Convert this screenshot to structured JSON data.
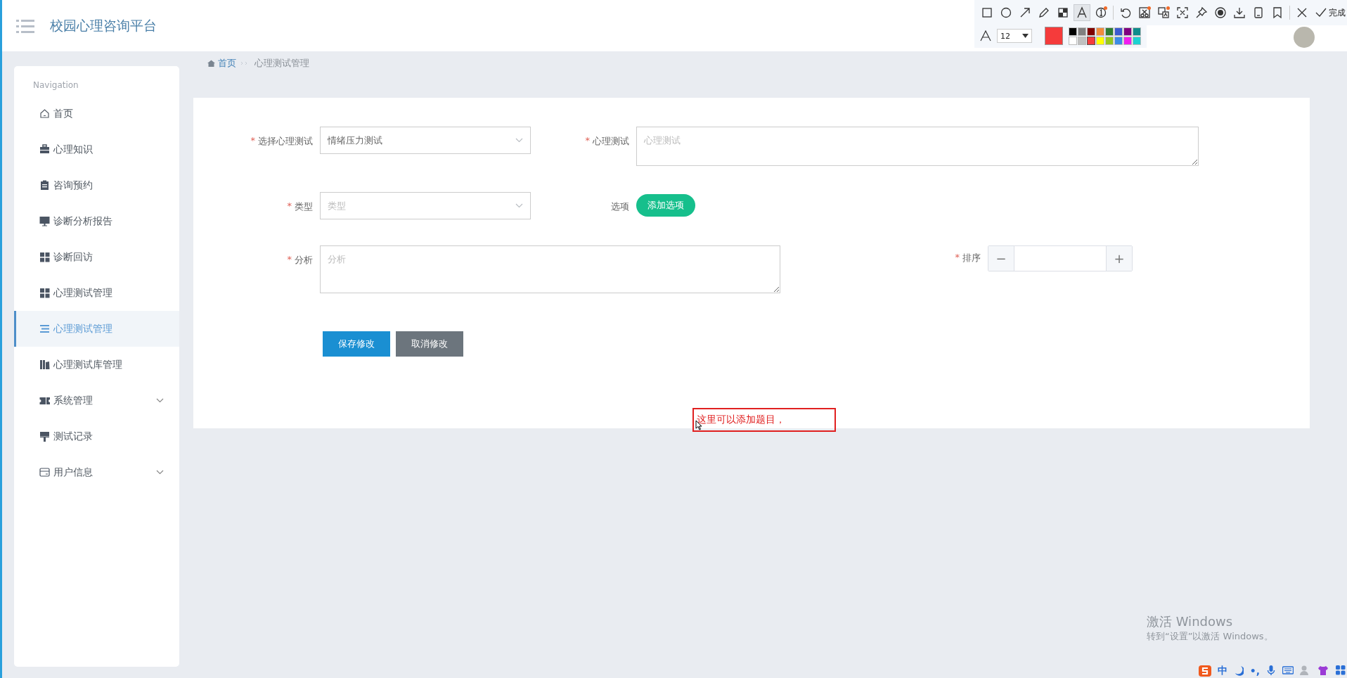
{
  "header": {
    "title": "校园心理咨询平台"
  },
  "breadcrumb": [
    {
      "label": "首页",
      "kind": "link"
    },
    {
      "label": "心理测试管理",
      "kind": "current"
    }
  ],
  "sidebar": {
    "heading": "Navigation",
    "items": [
      {
        "label": "首页",
        "kind": "home",
        "selected": false,
        "expandable": false
      },
      {
        "label": "心理知识",
        "kind": "briefcase",
        "selected": false,
        "expandable": false
      },
      {
        "label": "咨询预约",
        "kind": "clipboard",
        "selected": false,
        "expandable": false
      },
      {
        "label": "诊断分析报告",
        "kind": "monitor",
        "selected": false,
        "expandable": false
      },
      {
        "label": "诊断回访",
        "kind": "grid",
        "selected": false,
        "expandable": false
      },
      {
        "label": "心理测试管理",
        "kind": "grid",
        "selected": false,
        "expandable": false
      },
      {
        "label": "心理测试管理",
        "kind": "list",
        "selected": true,
        "expandable": false
      },
      {
        "label": "心理测试库管理",
        "kind": "books",
        "selected": false,
        "expandable": false
      },
      {
        "label": "系统管理",
        "kind": "ticket",
        "selected": false,
        "expandable": true
      },
      {
        "label": "测试记录",
        "kind": "brush",
        "selected": false,
        "expandable": false
      },
      {
        "label": "用户信息",
        "kind": "card",
        "selected": false,
        "expandable": true
      }
    ]
  },
  "form": {
    "rows": [
      [
        {
          "kind": "select",
          "mark": "*",
          "label": "选择心理测试",
          "value": "情绪压力测试"
        },
        {
          "kind": "textarea",
          "mark": "*",
          "label": "心理测试",
          "placeholder": "心理测试"
        }
      ],
      [
        {
          "kind": "select",
          "mark": "*",
          "label": "类型",
          "placeholder": "类型"
        },
        {
          "kind": "button",
          "label": "选项",
          "button": "添加选项"
        }
      ],
      [
        {
          "kind": "textarea",
          "mark": "*",
          "label": "分析",
          "placeholder": "分析"
        },
        {
          "kind": "stepper",
          "mark": "*",
          "label": "排序",
          "minus": "−",
          "plus": "+"
        }
      ]
    ],
    "buttons": [
      {
        "label": "保存修改",
        "kind": "primary"
      },
      {
        "label": "取消修改",
        "kind": "secondary"
      }
    ]
  },
  "annotation": {
    "text": "这里可以添加题目，"
  },
  "capture_toolbar": {
    "tools": [
      {
        "kind": "rect",
        "selected": false,
        "badge": false
      },
      {
        "kind": "ellipse",
        "selected": false,
        "badge": false
      },
      {
        "kind": "arrow",
        "selected": false,
        "badge": false
      },
      {
        "kind": "pencil",
        "selected": false,
        "badge": false
      },
      {
        "kind": "mosaic",
        "selected": false,
        "badge": false
      },
      {
        "kind": "text",
        "selected": true,
        "badge": false
      },
      {
        "kind": "number",
        "selected": false,
        "badge": true
      },
      {
        "kind": "sep"
      },
      {
        "kind": "undo",
        "selected": false,
        "badge": false
      },
      {
        "kind": "scissors",
        "selected": false,
        "badge": true
      },
      {
        "kind": "translate",
        "selected": false,
        "badge": true
      },
      {
        "kind": "ocr",
        "selected": false,
        "badge": false
      },
      {
        "kind": "pin",
        "selected": false,
        "badge": false
      },
      {
        "kind": "record",
        "selected": false,
        "badge": false
      },
      {
        "kind": "download",
        "selected": false,
        "badge": false
      },
      {
        "kind": "phone",
        "selected": false,
        "badge": false
      },
      {
        "kind": "bookmark",
        "selected": false,
        "badge": false
      },
      {
        "kind": "sep"
      },
      {
        "kind": "close",
        "selected": false,
        "badge": false
      }
    ],
    "done": "完成",
    "font_size": "12",
    "palette": [
      {
        "color": "#000000",
        "selected": false
      },
      {
        "color": "#808080",
        "selected": false
      },
      {
        "color": "#800000",
        "selected": false
      },
      {
        "color": "#f08c3c",
        "selected": false
      },
      {
        "color": "#2e7d32",
        "selected": false
      },
      {
        "color": "#3c5ad2",
        "selected": false
      },
      {
        "color": "#800080",
        "selected": false
      },
      {
        "color": "#0f8c8c",
        "selected": false
      },
      {
        "color": "#ffffff",
        "selected": false
      },
      {
        "color": "#c0c0c0",
        "selected": false
      },
      {
        "color": "#f53b3b",
        "selected": true
      },
      {
        "color": "#ffff00",
        "selected": false
      },
      {
        "color": "#96c81e",
        "selected": false
      },
      {
        "color": "#3c8ce6",
        "selected": false
      },
      {
        "color": "#f01ef0",
        "selected": false
      },
      {
        "color": "#1ed2d2",
        "selected": false
      }
    ]
  },
  "activation": {
    "title": "激活 Windows",
    "text": "转到“设置”以激活 Windows。"
  },
  "ime_bar": {
    "items": [
      {
        "kind": "logo"
      },
      {
        "kind": "lang",
        "text": "中"
      },
      {
        "kind": "moon"
      },
      {
        "kind": "punct",
        "text": "•,"
      },
      {
        "kind": "mic"
      },
      {
        "kind": "keyboard"
      },
      {
        "kind": "user"
      },
      {
        "kind": "shirt"
      },
      {
        "kind": "apps"
      }
    ]
  }
}
